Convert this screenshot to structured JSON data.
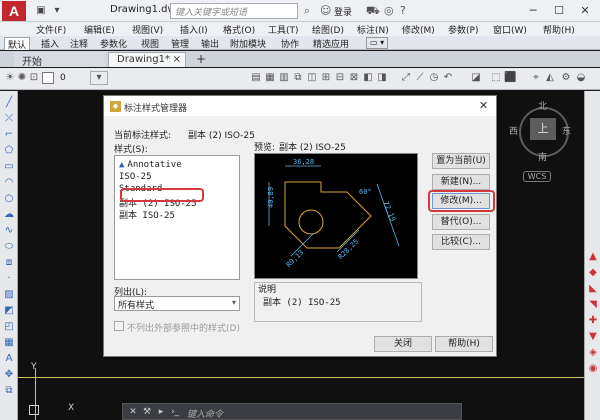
{
  "title_bar": {
    "app_logo": "A",
    "doc_title": "Drawing1.dwg",
    "search_placeholder": "键入关键字或短语",
    "login_label": "登录"
  },
  "menu": [
    "文件(F)",
    "编辑(E)",
    "视图(V)",
    "插入(I)",
    "格式(O)",
    "工具(T)",
    "绘图(D)",
    "标注(N)",
    "修改(M)",
    "参数(P)",
    "窗口(W)",
    "帮助(H)"
  ],
  "ribbon_tabs": [
    "默认",
    "插入",
    "注释",
    "参数化",
    "视图",
    "管理",
    "输出",
    "附加模块",
    "协作",
    "精选应用"
  ],
  "doc_tabs": {
    "start": "开始",
    "current": "Drawing1*",
    "add": "+"
  },
  "layer_bar": {
    "layer_value": "0"
  },
  "viewcube": {
    "north": "北",
    "south": "南",
    "east": "东",
    "west": "西",
    "top": "上",
    "wcs": "WCS"
  },
  "canvas": {
    "axis_y": "Y",
    "axis_x": "X"
  },
  "command_line": {
    "placeholder": "键入命令"
  },
  "dialog": {
    "title": "标注样式管理器",
    "current_style_label": "当前标注样式:",
    "current_style_value": "副本 (2) ISO-25",
    "styles_label": "样式(S):",
    "styles": [
      "Annotative",
      "ISO-25",
      "Standard",
      "副本 (2) ISO-25",
      "副本 ISO-25"
    ],
    "list_label": "列出(L):",
    "list_value": "所有样式",
    "exclude_xref_label": "不列出外部参照中的样式(D)",
    "preview_label": "预览:",
    "preview_value": "副本 (2) ISO-25",
    "description_label": "说明",
    "description_value": "副本 (2) ISO-25",
    "buttons": {
      "set_current": "置为当前(U)",
      "new": "新建(N)...",
      "modify": "修改(M)...",
      "override": "替代(O)...",
      "compare": "比较(C)...",
      "close": "关闭",
      "help": "帮助(H)"
    },
    "preview_dims": [
      "36,28",
      "40,89",
      "72,19",
      "R28,25",
      "R9,13",
      "60°"
    ]
  },
  "colors": {
    "accent_red": "#d23b3b",
    "preview_line": "#d8a53a",
    "preview_dim": "#5bb7f0"
  }
}
